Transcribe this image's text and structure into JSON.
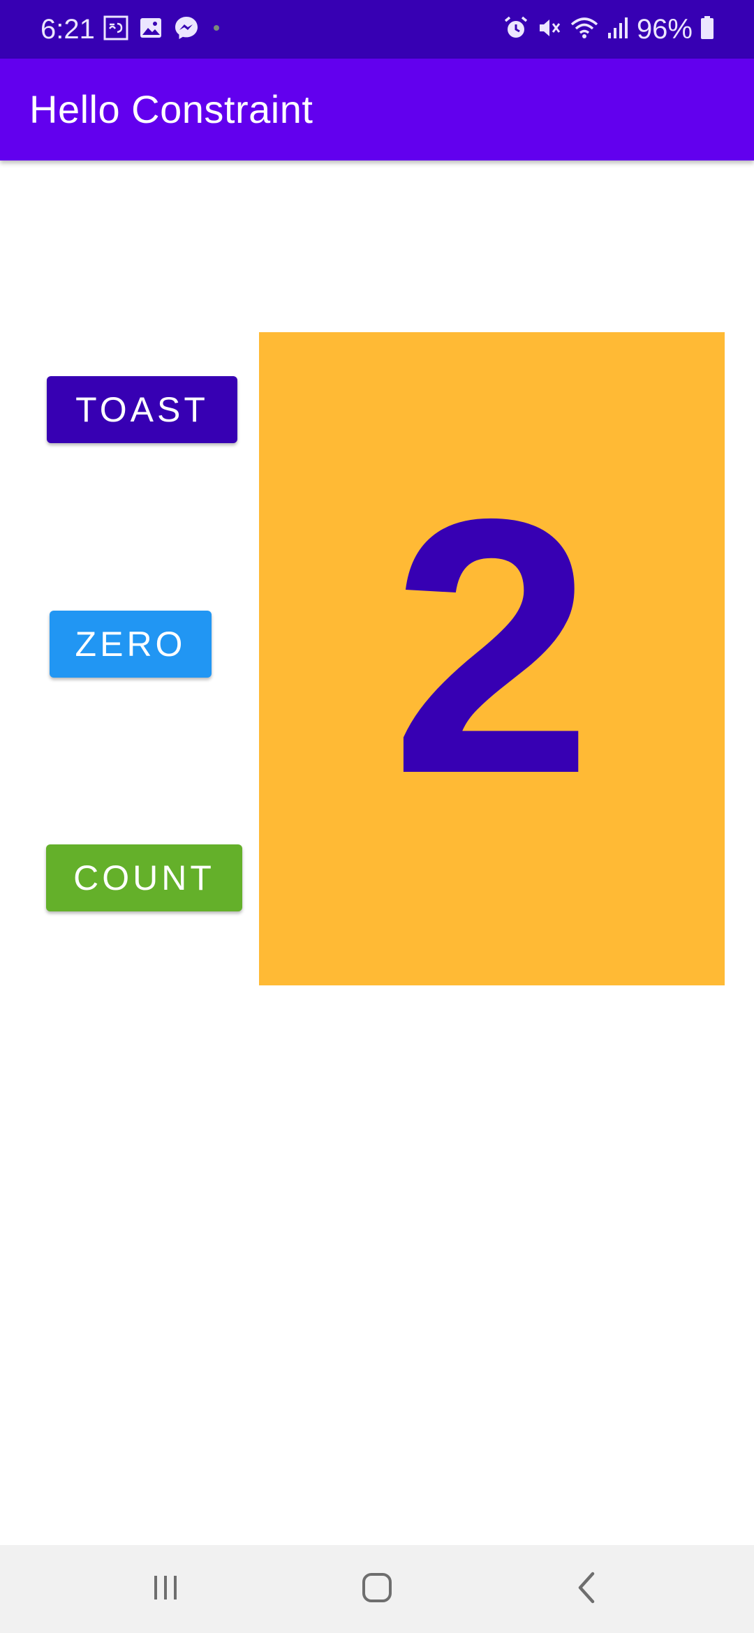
{
  "status_bar": {
    "time": "6:21",
    "left_icons": [
      "keyboard-language-icon",
      "gallery-icon",
      "messenger-icon",
      "notification-dot-icon"
    ],
    "right_icons": [
      "alarm-icon",
      "vibrate-mute-icon",
      "wifi-icon",
      "signal-icon",
      "battery-icon"
    ],
    "battery": "96%"
  },
  "app_bar": {
    "title": "Hello Constraint"
  },
  "buttons": {
    "toast": "TOAST",
    "zero": "ZERO",
    "count": "COUNT"
  },
  "count_panel": {
    "value": "2"
  },
  "nav_bar": {
    "icons": [
      "recents-icon",
      "home-icon",
      "back-icon"
    ]
  },
  "colors": {
    "status_bar": "#3700b3",
    "app_bar": "#6200ee",
    "toast_button": "#3700b3",
    "zero_button": "#2196f3",
    "count_button": "#64b02a",
    "count_panel": "#ffba35",
    "count_text": "#3700b3"
  }
}
